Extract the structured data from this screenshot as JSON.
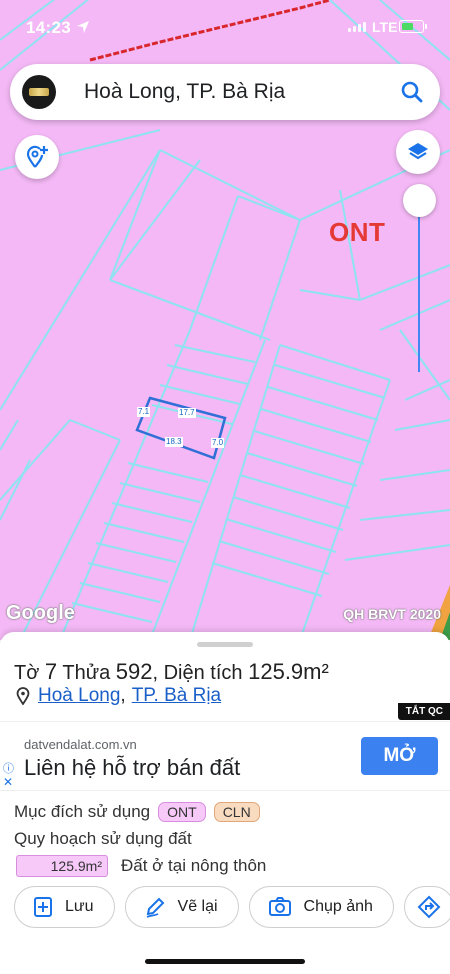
{
  "status_bar": {
    "time": "14:23",
    "network": "LTE"
  },
  "search": {
    "query": "Hoà Long, TP. Bà Rịa"
  },
  "map": {
    "zone_code": "ONT",
    "zone_color": "#e53935",
    "land_color": "#f3b8f5",
    "parcel_line_color": "#8ee3f0",
    "selected_parcel_color": "#2f6fd6",
    "google_logo": "Google",
    "credit": "QH BRVT 2020",
    "dimensions": {
      "left": "7.1",
      "top": "17.7",
      "bottom": "18.3",
      "right": "7.0"
    }
  },
  "parcel": {
    "sheet_label": "Tờ",
    "sheet_no": "7",
    "lot_label": "Thửa",
    "lot_no": "592",
    "area_label": ", Diện tích",
    "area": "125.9m²",
    "commune": "Hoà Long",
    "city": "TP. Bà Rịa"
  },
  "ad": {
    "close_tag": "TẮT QC",
    "domain": "datvendalat.com.vn",
    "headline": "Liên hệ hỗ trợ bán đất",
    "cta": "MỞ",
    "cta_color": "#3b82f0",
    "info_icon": "ⓘ",
    "close_icon": "✕"
  },
  "usage": {
    "purpose_label": "Mục đích sử dụng",
    "codes": [
      "ONT",
      "CLN"
    ],
    "planning_label": "Quy hoạch sử dụng đất",
    "planned_area": "125.9m²",
    "planned_desc": "Đất ở tại nông thôn"
  },
  "actions": [
    {
      "label": "Lưu",
      "icon": "bookmark-plus-icon"
    },
    {
      "label": "Vẽ lại",
      "icon": "edit-pen-icon"
    },
    {
      "label": "Chụp ảnh",
      "icon": "camera-icon"
    },
    {
      "label": "",
      "icon": "directions-icon"
    }
  ]
}
